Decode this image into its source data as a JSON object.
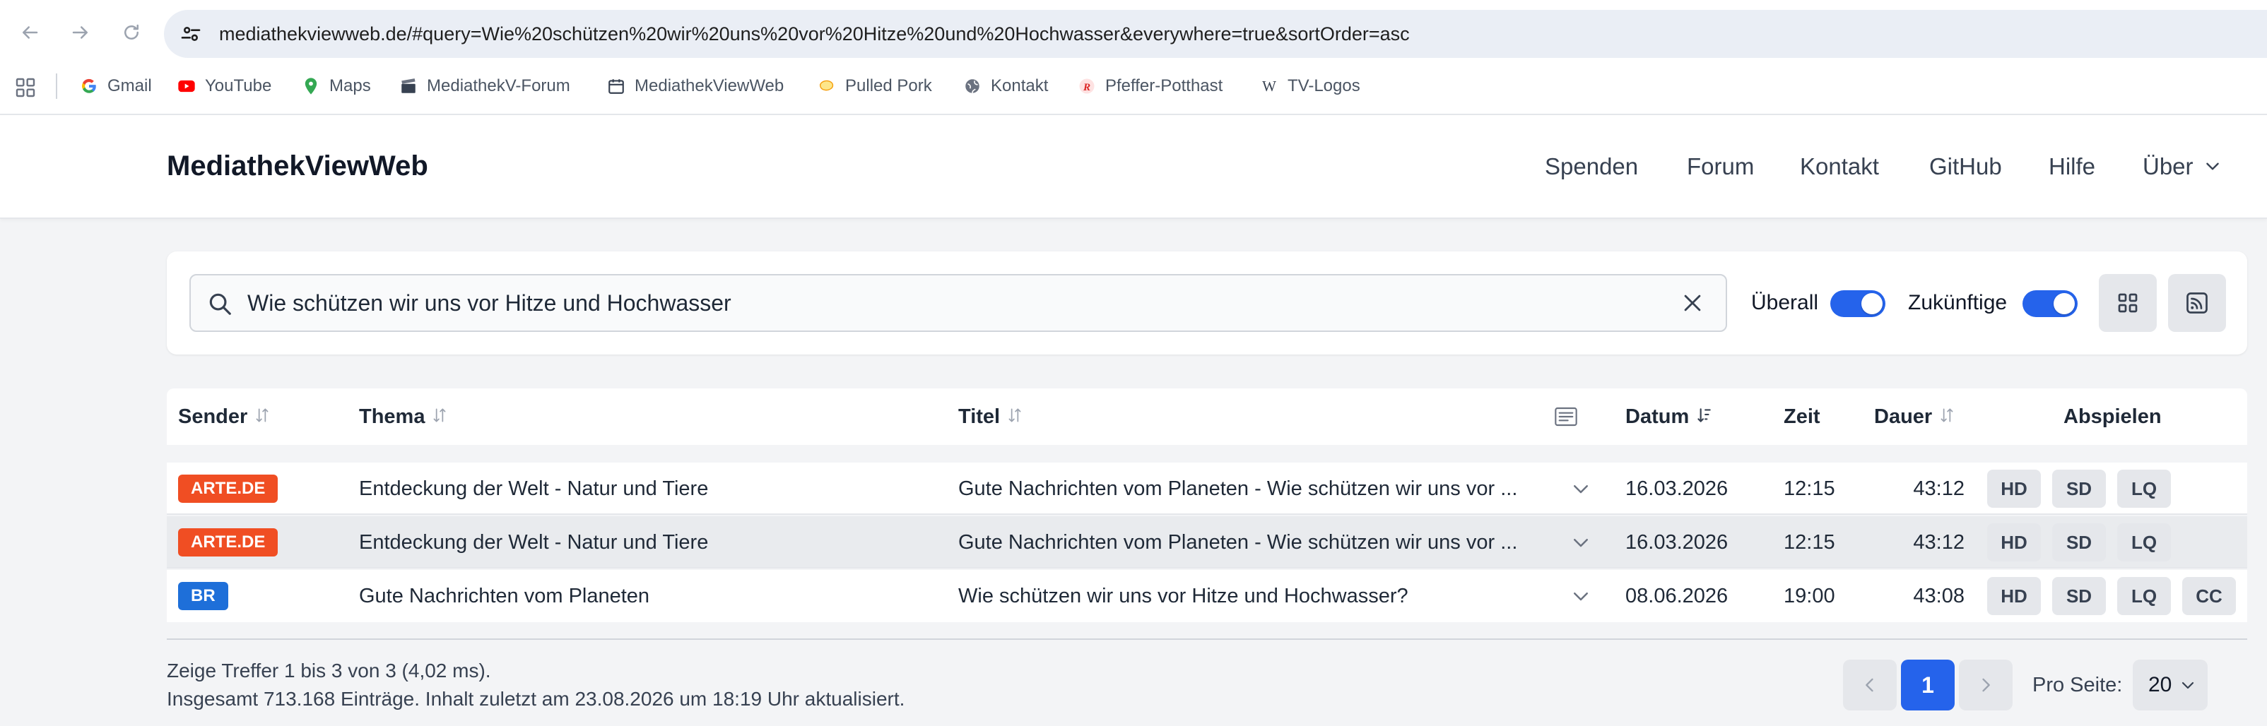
{
  "browser": {
    "url": "mediathekviewweb.de/#query=Wie%20schützen%20wir%20uns%20vor%20Hitze%20und%20Hochwasser&everywhere=true&sortOrder=asc",
    "bookmarks": [
      "Gmail",
      "YouTube",
      "Maps",
      "MediathekV-Forum",
      "MediathekViewWeb",
      "Pulled Pork",
      "Kontakt",
      "Pfeffer-Potthast",
      "TV-Logos"
    ]
  },
  "header": {
    "brand": "MediathekViewWeb",
    "nav": [
      "Spenden",
      "Forum",
      "Kontakt",
      "GitHub",
      "Hilfe",
      "Über"
    ]
  },
  "search": {
    "query": "Wie schützen wir uns vor Hitze und Hochwasser",
    "everywhere_label": "Überall",
    "everywhere_on": true,
    "future_label": "Zukünftige",
    "future_on": true
  },
  "table": {
    "columns": {
      "sender": "Sender",
      "thema": "Thema",
      "titel": "Titel",
      "datum": "Datum",
      "zeit": "Zeit",
      "dauer": "Dauer",
      "abspielen": "Abspielen"
    },
    "rows": [
      {
        "sender": "ARTE.DE",
        "thema": "Entdeckung der Welt - Natur und Tiere",
        "titel": "Gute Nachrichten vom Planeten - Wie schützen wir uns vor ...",
        "datum": "16.03.2026",
        "zeit": "12:15",
        "dauer": "43:12",
        "qualities": [
          "HD",
          "SD",
          "LQ"
        ]
      },
      {
        "sender": "ARTE.DE",
        "thema": "Entdeckung der Welt - Natur und Tiere",
        "titel": "Gute Nachrichten vom Planeten - Wie schützen wir uns vor ...",
        "datum": "16.03.2026",
        "zeit": "12:15",
        "dauer": "43:12",
        "qualities": [
          "HD",
          "SD",
          "LQ"
        ]
      },
      {
        "sender": "BR",
        "thema": "Gute Nachrichten vom Planeten",
        "titel": "Wie schützen wir uns vor Hitze und Hochwasser?",
        "datum": "08.06.2026",
        "zeit": "19:00",
        "dauer": "43:08",
        "qualities": [
          "HD",
          "SD",
          "LQ",
          "CC"
        ]
      }
    ]
  },
  "footer": {
    "results": "Zeige Treffer 1 bis 3 von 3 (4,02 ms).",
    "total": "Insgesamt 713.168 Einträge.  Inhalt zuletzt am 23.08.2026 um 18:19 Uhr aktualisiert.",
    "current_page": "1",
    "per_page_label": "Pro Seite:",
    "per_page": "20"
  },
  "colors": {
    "accent": "#2563eb",
    "arte": "#f04e23",
    "br": "#1e6fd9"
  }
}
